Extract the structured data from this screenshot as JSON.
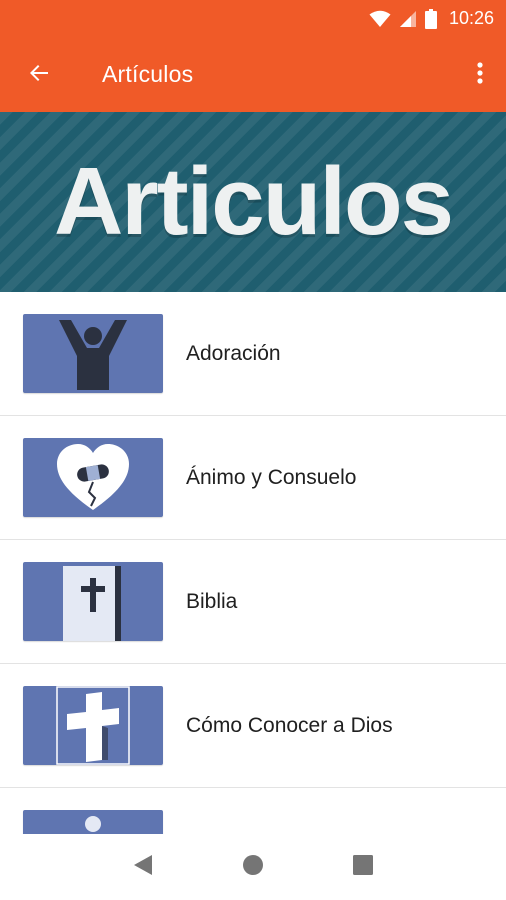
{
  "status_bar": {
    "time": "10:26"
  },
  "toolbar": {
    "title": "Artículos"
  },
  "banner": {
    "text": "Articulos"
  },
  "articles": [
    {
      "label": "Adoración",
      "icon": "worship-figure-icon"
    },
    {
      "label": "Ánimo y Consuelo",
      "icon": "mended-heart-icon"
    },
    {
      "label": "Biblia",
      "icon": "bible-icon"
    },
    {
      "label": "Cómo Conocer a Dios",
      "icon": "cross-icon"
    },
    {
      "label": "",
      "icon": "person-icon"
    }
  ],
  "colors": {
    "accent": "#f05a28",
    "banner_bg": "#1f5e6f",
    "thumb_bg": "#5f75b1",
    "icon_dark": "#2b3140"
  }
}
